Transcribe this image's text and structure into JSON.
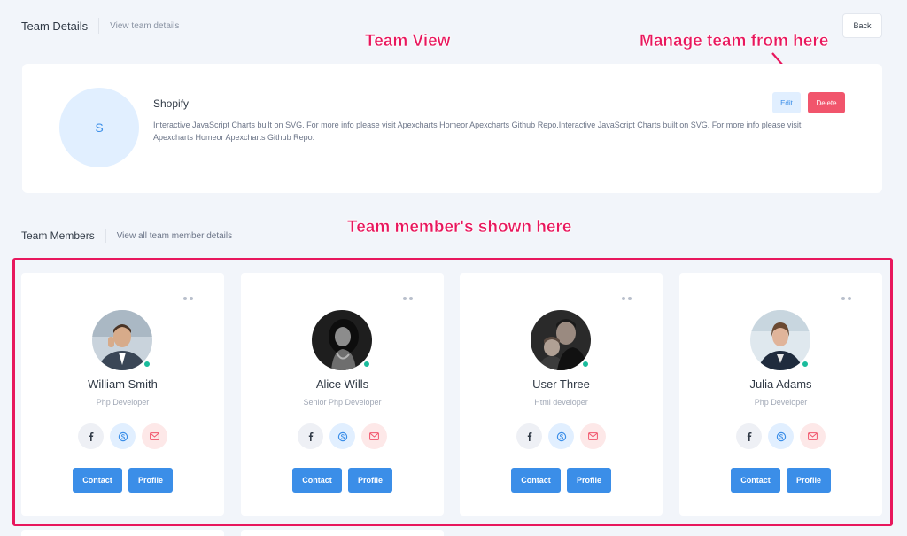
{
  "header": {
    "title": "Team Details",
    "subtitle": "View team details",
    "back_label": "Back"
  },
  "annotations": {
    "team_view": "Team View",
    "manage": "Manage team from here",
    "members": "Team member's shown here"
  },
  "team": {
    "initial": "S",
    "name": "Shopify",
    "description": "Interactive JavaScript Charts built on SVG. For more info please visit Apexcharts Homeor Apexcharts Github Repo.Interactive JavaScript Charts built on SVG. For more info please visit Apexcharts Homeor Apexcharts Github Repo.",
    "edit_label": "Edit",
    "delete_label": "Delete"
  },
  "members_section": {
    "title": "Team Members",
    "subtitle": "View all team member details"
  },
  "members": [
    {
      "name": "William Smith",
      "role": "Php Developer",
      "contact_label": "Contact",
      "profile_label": "Profile"
    },
    {
      "name": "Alice Wills",
      "role": "Senior Php Developer",
      "contact_label": "Contact",
      "profile_label": "Profile"
    },
    {
      "name": "User Three",
      "role": "Html developer",
      "contact_label": "Contact",
      "profile_label": "Profile"
    },
    {
      "name": "Julia Adams",
      "role": "Php Developer",
      "contact_label": "Contact",
      "profile_label": "Profile"
    }
  ],
  "icons": {
    "social": [
      "facebook-icon",
      "skype-icon",
      "mail-icon"
    ],
    "menu": "more-dots-icon"
  },
  "colors": {
    "primary": "#3b8ee8",
    "danger": "#f1556c",
    "online": "#1abc9c",
    "annotation": "#e8175d"
  }
}
